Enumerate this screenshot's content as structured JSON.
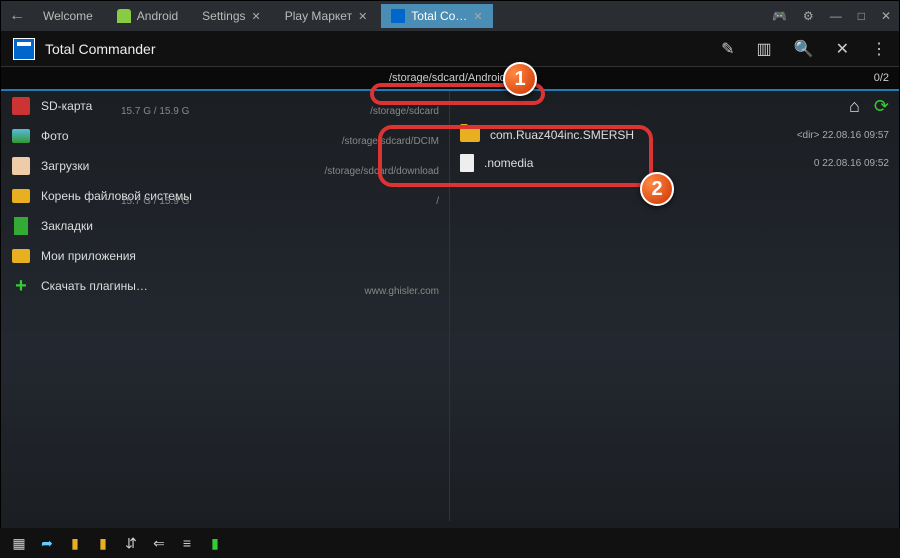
{
  "tabs": {
    "t0": "Welcome",
    "t1": "Android",
    "t2": "Settings",
    "t3": "Play Маркет",
    "t4": "Total Co…"
  },
  "app": {
    "title": "Total Commander"
  },
  "path": {
    "text": "/storage/sdcard/Android/obb",
    "count": "0/2"
  },
  "left": {
    "items": [
      {
        "name": "SD-карта",
        "sub": "/storage/sdcard",
        "sub2": "15.7 G / 15.9 G"
      },
      {
        "name": "Фото",
        "sub": "/storage/sdcard/DCIM"
      },
      {
        "name": "Загрузки",
        "sub": "/storage/sdcard/download"
      },
      {
        "name": "Корень файловой системы",
        "sub": "/",
        "sub2": "15.7 G / 15.9 G"
      },
      {
        "name": "Закладки"
      },
      {
        "name": "Мои приложения"
      },
      {
        "name": "Скачать плагины…",
        "sub": "www.ghisler.com"
      }
    ]
  },
  "right": {
    "items": [
      {
        "name": "com.Ruaz404inc.SMERSH",
        "meta": "<dir>  22.08.16  09:57",
        "type": "folder"
      },
      {
        "name": ".nomedia",
        "meta": "0  22.08.16  09:52",
        "type": "file"
      }
    ]
  },
  "badges": {
    "b1": "1",
    "b2": "2"
  }
}
